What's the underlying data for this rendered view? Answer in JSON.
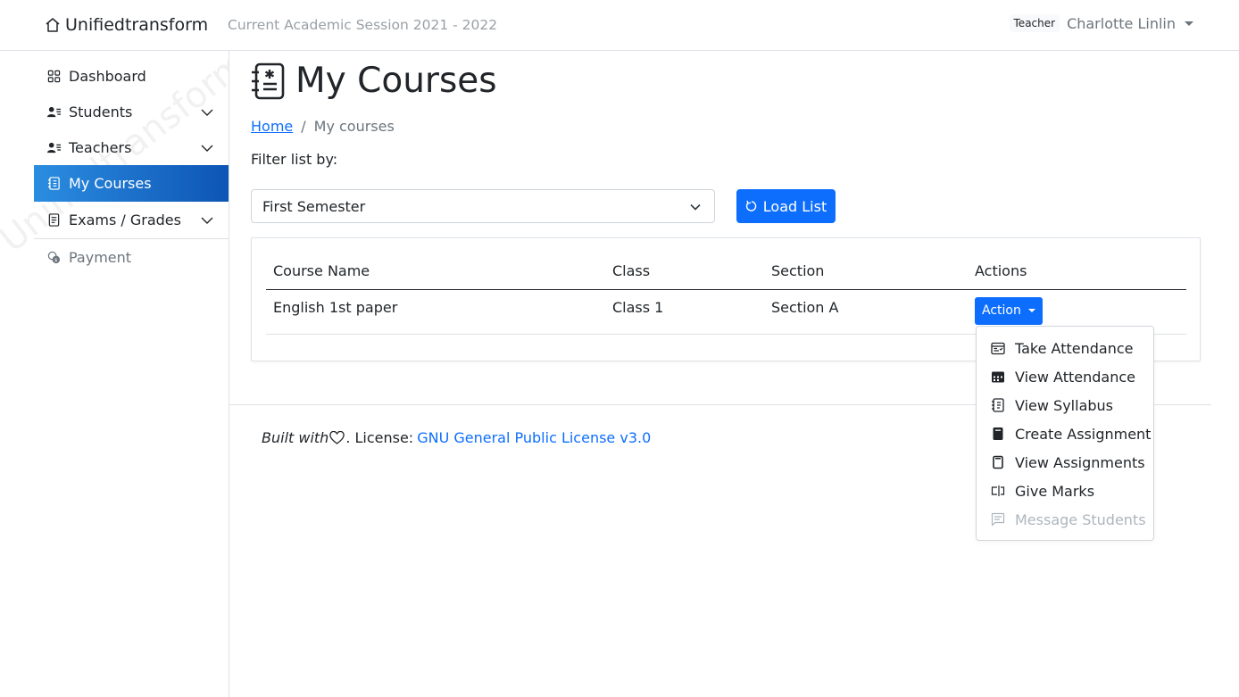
{
  "header": {
    "brand": "Unifiedtransform",
    "brand_icon": "house-icon",
    "session": "Current Academic Session 2021 - 2022",
    "role_badge": "Teacher",
    "user_name": "Charlotte Linlin"
  },
  "sidebar": {
    "watermark": "Unifiedtransform",
    "items": [
      {
        "label": "Dashboard",
        "icon": "grid-icon"
      },
      {
        "label": "Students",
        "icon": "person-lines-icon"
      },
      {
        "label": "Teachers",
        "icon": "person-lines-icon"
      },
      {
        "label": "My Courses",
        "icon": "journal-icon",
        "active": true
      },
      {
        "label": "Exams / Grades",
        "icon": "file-text-icon"
      },
      {
        "label": "Payment",
        "icon": "coins-icon"
      }
    ]
  },
  "main": {
    "title": "My Courses",
    "breadcrumb": {
      "home": "Home",
      "separator": "/",
      "current": "My courses"
    },
    "filter_label": "Filter list by:",
    "semester_select": {
      "value": "First Semester"
    },
    "load_button": "Load List",
    "table": {
      "headers": [
        "Course Name",
        "Class",
        "Section",
        "Actions"
      ],
      "rows": [
        {
          "course": "English 1st paper",
          "class": "Class 1",
          "section": "Section A",
          "action": "Action"
        }
      ]
    },
    "action_menu": [
      {
        "label": "Take Attendance",
        "icon": "calendar-check-icon"
      },
      {
        "label": "View Attendance",
        "icon": "calendar-filled-icon"
      },
      {
        "label": "View Syllabus",
        "icon": "journal-text-icon"
      },
      {
        "label": "Create Assignment",
        "icon": "file-filled-icon"
      },
      {
        "label": "View Assignments",
        "icon": "file-outline-icon"
      },
      {
        "label": "Give Marks",
        "icon": "input-cursor-icon"
      },
      {
        "label": "Message Students",
        "icon": "chat-lines-icon",
        "disabled": true
      }
    ]
  },
  "footer": {
    "built_with": "Built with",
    "license_prefix": ". License:",
    "license_link": "GNU General Public License v3.0"
  },
  "colors": {
    "primary": "#0d6efd",
    "active_nav_start": "#2b8de0",
    "active_nav_end": "#0d55b5"
  }
}
